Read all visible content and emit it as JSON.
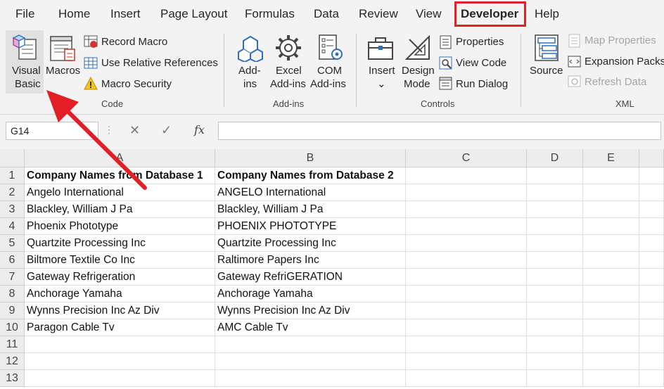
{
  "tabs": [
    "File",
    "Home",
    "Insert",
    "Page Layout",
    "Formulas",
    "Data",
    "Review",
    "View",
    "Developer",
    "Help"
  ],
  "ribbon": {
    "code": {
      "visual_basic": [
        "Visual",
        "Basic"
      ],
      "macros": "Macros",
      "record_macro": "Record Macro",
      "relative_refs": "Use Relative References",
      "macro_security": "Macro Security",
      "group_label": "Code"
    },
    "addins": {
      "addins": [
        "Add-",
        "ins"
      ],
      "excel_addins": [
        "Excel",
        "Add-ins"
      ],
      "com_addins": [
        "COM",
        "Add-ins"
      ],
      "group_label": "Add-ins"
    },
    "controls": {
      "insert": "Insert",
      "design_mode": [
        "Design",
        "Mode"
      ],
      "properties": "Properties",
      "view_code": "View Code",
      "run_dialog": "Run Dialog",
      "group_label": "Controls"
    },
    "xml": {
      "source": "Source",
      "map_properties": "Map Properties",
      "expansion_packs": "Expansion Packs",
      "refresh_data": "Refresh Data",
      "group_label": "XML"
    }
  },
  "formula_bar": {
    "name_box": "G14",
    "fx": "fx",
    "formula": ""
  },
  "sheet": {
    "columns": [
      "A",
      "B",
      "C",
      "D",
      "E"
    ],
    "rows": [
      [
        "Company Names from Database 1",
        "Company Names from Database 2"
      ],
      [
        "Angelo International",
        "ANGELO International"
      ],
      [
        "Blackley, William J Pa",
        "Blackley, William J Pa"
      ],
      [
        "Phoenix Phototype",
        "PHOENIX PHOTOTYPE"
      ],
      [
        "Quartzite Processing Inc",
        "Quartzite Processing Inc"
      ],
      [
        "Biltmore Textile Co Inc",
        "Raltimore Papers Inc"
      ],
      [
        "Gateway Refrigeration",
        "Gateway RefriGERATION"
      ],
      [
        "Anchorage Yamaha",
        "Anchorage Yamaha"
      ],
      [
        "Wynns Precision Inc Az Div",
        "Wynns Precision Inc Az Div"
      ],
      [
        "Paragon Cable Tv",
        "AMC Cable Tv"
      ],
      [
        "",
        ""
      ],
      [
        "",
        ""
      ],
      [
        "",
        ""
      ]
    ],
    "row_numbers": [
      "1",
      "2",
      "3",
      "4",
      "5",
      "6",
      "7",
      "8",
      "9",
      "10",
      "11",
      "12",
      "13"
    ]
  },
  "colors": {
    "highlight": "#e21f26",
    "excel_green": "#217346"
  }
}
